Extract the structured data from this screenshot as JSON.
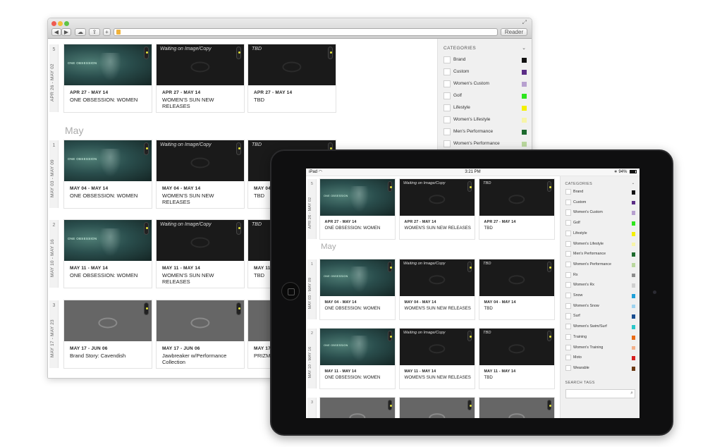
{
  "browser": {
    "toolbar": {
      "back": "◀",
      "forward": "▶",
      "reader_label": "Reader"
    },
    "weeks": [
      {
        "num": "5",
        "range": "APR 26 - MAY 02",
        "cards": [
          {
            "kind": "photo",
            "caption": "ONE OBSESSION",
            "date": "APR 27 - MAY 14",
            "title": "ONE OBSESSION: WOMEN"
          },
          {
            "kind": "dark",
            "waiting": "Waiting on Image/Copy",
            "date": "APR 27 - MAY 14",
            "title": "WOMEN'S SUN NEW RELEASES"
          },
          {
            "kind": "dark",
            "waiting": "TBD",
            "date": "APR 27 - MAY 14",
            "title": "TBD"
          }
        ]
      },
      {
        "num": "1",
        "range": "MAY 03 - MAY 09",
        "cards": [
          {
            "kind": "photo",
            "caption": "ONE OBSESSION",
            "date": "MAY 04 - MAY 14",
            "title": "ONE OBSESSION: WOMEN"
          },
          {
            "kind": "dark",
            "waiting": "Waiting on Image/Copy",
            "date": "MAY 04 - MAY 14",
            "title": "WOMEN'S SUN NEW RELEASES"
          },
          {
            "kind": "dark",
            "waiting": "TBD",
            "date": "MAY 04",
            "title": "TBD"
          }
        ]
      },
      {
        "num": "2",
        "range": "MAY 10 - MAY 16",
        "cards": [
          {
            "kind": "photo",
            "caption": "ONE OBSESSION",
            "date": "MAY 11 - MAY 14",
            "title": "ONE OBSESSION: WOMEN"
          },
          {
            "kind": "dark",
            "waiting": "Waiting on Image/Copy",
            "date": "MAY 11 - MAY 14",
            "title": "WOMEN'S SUN NEW RELEASES"
          },
          {
            "kind": "dark",
            "waiting": "TBD",
            "date": "MAY 11",
            "title": "TBD"
          }
        ]
      },
      {
        "num": "3",
        "range": "MAY 17 - MAY 23",
        "cards": [
          {
            "kind": "gray",
            "date": "MAY 17 - JUN 06",
            "title": "Brand Story: Cavendish"
          },
          {
            "kind": "gray",
            "date": "MAY 17 - JUN 06",
            "title": "Jawbreaker w/Performance Collection"
          },
          {
            "kind": "gray",
            "date": "MAY 17",
            "title": "PRIZM"
          }
        ]
      }
    ],
    "month": "May",
    "sidebar": {
      "heading": "CATEGORIES",
      "categories": [
        {
          "label": "Brand",
          "color": "#111111"
        },
        {
          "label": "Custom",
          "color": "#5b2d86"
        },
        {
          "label": "Women's Custom",
          "color": "#b7a0cf"
        },
        {
          "label": "Golf",
          "color": "#2ee51e"
        },
        {
          "label": "Lifestyle",
          "color": "#f4f000"
        },
        {
          "label": "Women's Lifestyle",
          "color": "#f7f4a8"
        },
        {
          "label": "Men's Performance",
          "color": "#1d6a2e"
        },
        {
          "label": "Women's Performance",
          "color": "#b9d79e"
        }
      ]
    }
  },
  "ipad": {
    "status": {
      "device": "iPad",
      "time": "3:21 PM",
      "battery": "94%"
    },
    "weeks": [
      {
        "num": "5",
        "range": "APR 26 - MAY 02",
        "cards": [
          {
            "kind": "photo",
            "caption": "ONE OBSESSION",
            "date": "APR 27 - MAY 14",
            "title": "ONE OBSESSION: WOMEN"
          },
          {
            "kind": "dark",
            "waiting": "Waiting on Image/Copy",
            "date": "APR 27 - MAY 14",
            "title": "WOMEN'S SUN NEW RELEASES"
          },
          {
            "kind": "dark",
            "waiting": "TBD",
            "date": "APR 27 - MAY 14",
            "title": "TBD"
          }
        ]
      },
      {
        "num": "1",
        "range": "MAY 03 - MAY 09",
        "cards": [
          {
            "kind": "photo",
            "caption": "ONE OBSESSION",
            "date": "MAY 04 - MAY 14",
            "title": "ONE OBSESSION: WOMEN"
          },
          {
            "kind": "dark",
            "waiting": "Waiting on Image/Copy",
            "date": "MAY 04 - MAY 14",
            "title": "WOMEN'S SUN NEW RELEASES"
          },
          {
            "kind": "dark",
            "waiting": "TBD",
            "date": "MAY 04 - MAY 14",
            "title": "TBD"
          }
        ]
      },
      {
        "num": "2",
        "range": "MAY 10 - MAY 16",
        "cards": [
          {
            "kind": "photo",
            "caption": "ONE OBSESSION",
            "date": "MAY 11 - MAY 14",
            "title": "ONE OBSESSION: WOMEN"
          },
          {
            "kind": "dark",
            "waiting": "Waiting on Image/Copy",
            "date": "MAY 11 - MAY 14",
            "title": "WOMEN'S SUN NEW RELEASES"
          },
          {
            "kind": "dark",
            "waiting": "TBD",
            "date": "MAY 11 - MAY 14",
            "title": "TBD"
          }
        ]
      },
      {
        "num": "3",
        "range": "",
        "cards": [
          {
            "kind": "gray"
          },
          {
            "kind": "gray"
          },
          {
            "kind": "gray"
          }
        ]
      }
    ],
    "month": "May",
    "sidebar": {
      "heading": "CATEGORIES",
      "categories": [
        {
          "label": "Brand",
          "color": "#111111"
        },
        {
          "label": "Custom",
          "color": "#5b2d86"
        },
        {
          "label": "Women's Custom",
          "color": "#b7a0cf"
        },
        {
          "label": "Golf",
          "color": "#2ee51e"
        },
        {
          "label": "Lifestyle",
          "color": "#f4f000"
        },
        {
          "label": "Women's Lifestyle",
          "color": "#f7f4a8"
        },
        {
          "label": "Men's Performance",
          "color": "#1d6a2e"
        },
        {
          "label": "Women's Performance",
          "color": "#b9d79e"
        },
        {
          "label": "Rx",
          "color": "#8c8c8c"
        },
        {
          "label": "Women's Rx",
          "color": "#cfcfcf"
        },
        {
          "label": "Snow",
          "color": "#1fa0d8"
        },
        {
          "label": "Women's Snow",
          "color": "#9fd3ef"
        },
        {
          "label": "Surf",
          "color": "#1a4d8f"
        },
        {
          "label": "Women's Swim/Surf",
          "color": "#2bc7c9"
        },
        {
          "label": "Training",
          "color": "#e96b16"
        },
        {
          "label": "Women's Training",
          "color": "#f3b08a"
        },
        {
          "label": "Moto",
          "color": "#d61f1f"
        },
        {
          "label": "Wearable",
          "color": "#6b3a14"
        }
      ],
      "search_heading": "SEARCH TAGS",
      "search_placeholder": ""
    }
  }
}
